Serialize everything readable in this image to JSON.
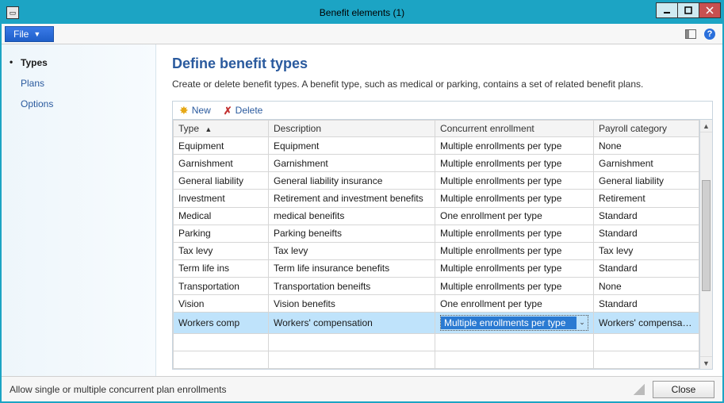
{
  "window": {
    "title": "Benefit elements (1)"
  },
  "menubar": {
    "file_label": "File"
  },
  "sidebar": {
    "items": [
      {
        "label": "Types",
        "active": true
      },
      {
        "label": "Plans",
        "active": false
      },
      {
        "label": "Options",
        "active": false
      }
    ]
  },
  "page": {
    "title": "Define benefit types",
    "description": "Create or delete benefit types.  A benefit type, such as medical or parking,  contains a set of related benefit plans."
  },
  "toolbar": {
    "new_label": "New",
    "delete_label": "Delete"
  },
  "grid": {
    "columns": {
      "type": "Type",
      "description": "Description",
      "concurrent": "Concurrent enrollment",
      "payroll": "Payroll category"
    },
    "sort_indicator": "▲",
    "rows": [
      {
        "type": "Equipment",
        "description": "Equipment",
        "concurrent": "Multiple enrollments per type",
        "payroll": "None"
      },
      {
        "type": "Garnishment",
        "description": "Garnishment",
        "concurrent": "Multiple enrollments per type",
        "payroll": "Garnishment"
      },
      {
        "type": "General liability",
        "description": "General liability insurance",
        "concurrent": "Multiple enrollments per type",
        "payroll": "General liability"
      },
      {
        "type": "Investment",
        "description": "Retirement and investment benefits",
        "concurrent": "Multiple enrollments per type",
        "payroll": "Retirement"
      },
      {
        "type": "Medical",
        "description": "medical beneifits",
        "concurrent": "One enrollment per type",
        "payroll": "Standard"
      },
      {
        "type": "Parking",
        "description": "Parking beneifts",
        "concurrent": "Multiple enrollments per type",
        "payroll": "Standard"
      },
      {
        "type": "Tax levy",
        "description": "Tax levy",
        "concurrent": "Multiple enrollments per type",
        "payroll": "Tax levy"
      },
      {
        "type": "Term life ins",
        "description": "Term life insurance benefits",
        "concurrent": "Multiple enrollments per type",
        "payroll": "Standard"
      },
      {
        "type": "Transportation",
        "description": "Transportation beneifts",
        "concurrent": "Multiple enrollments per type",
        "payroll": "None"
      },
      {
        "type": "Vision",
        "description": "Vision benefits",
        "concurrent": "One enrollment per type",
        "payroll": "Standard"
      },
      {
        "type": "Workers comp",
        "description": "Workers' compensation",
        "concurrent": "Multiple enrollments per type",
        "payroll": "Workers' compensation",
        "selected": true
      }
    ]
  },
  "footer": {
    "status": "Allow single or multiple concurrent plan enrollments",
    "close_label": "Close"
  }
}
